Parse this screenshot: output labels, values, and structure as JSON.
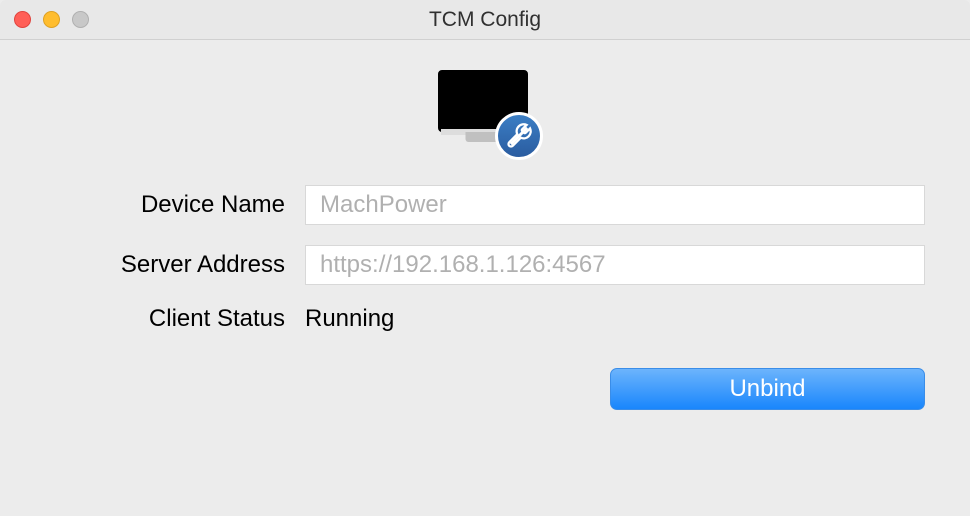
{
  "window": {
    "title": "TCM Config"
  },
  "form": {
    "device_name_label": "Device Name",
    "device_name_value": "MachPower",
    "server_address_label": "Server Address",
    "server_address_value": "https://192.168.1.126:4567",
    "client_status_label": "Client Status",
    "client_status_value": "Running"
  },
  "buttons": {
    "unbind_label": "Unbind"
  }
}
